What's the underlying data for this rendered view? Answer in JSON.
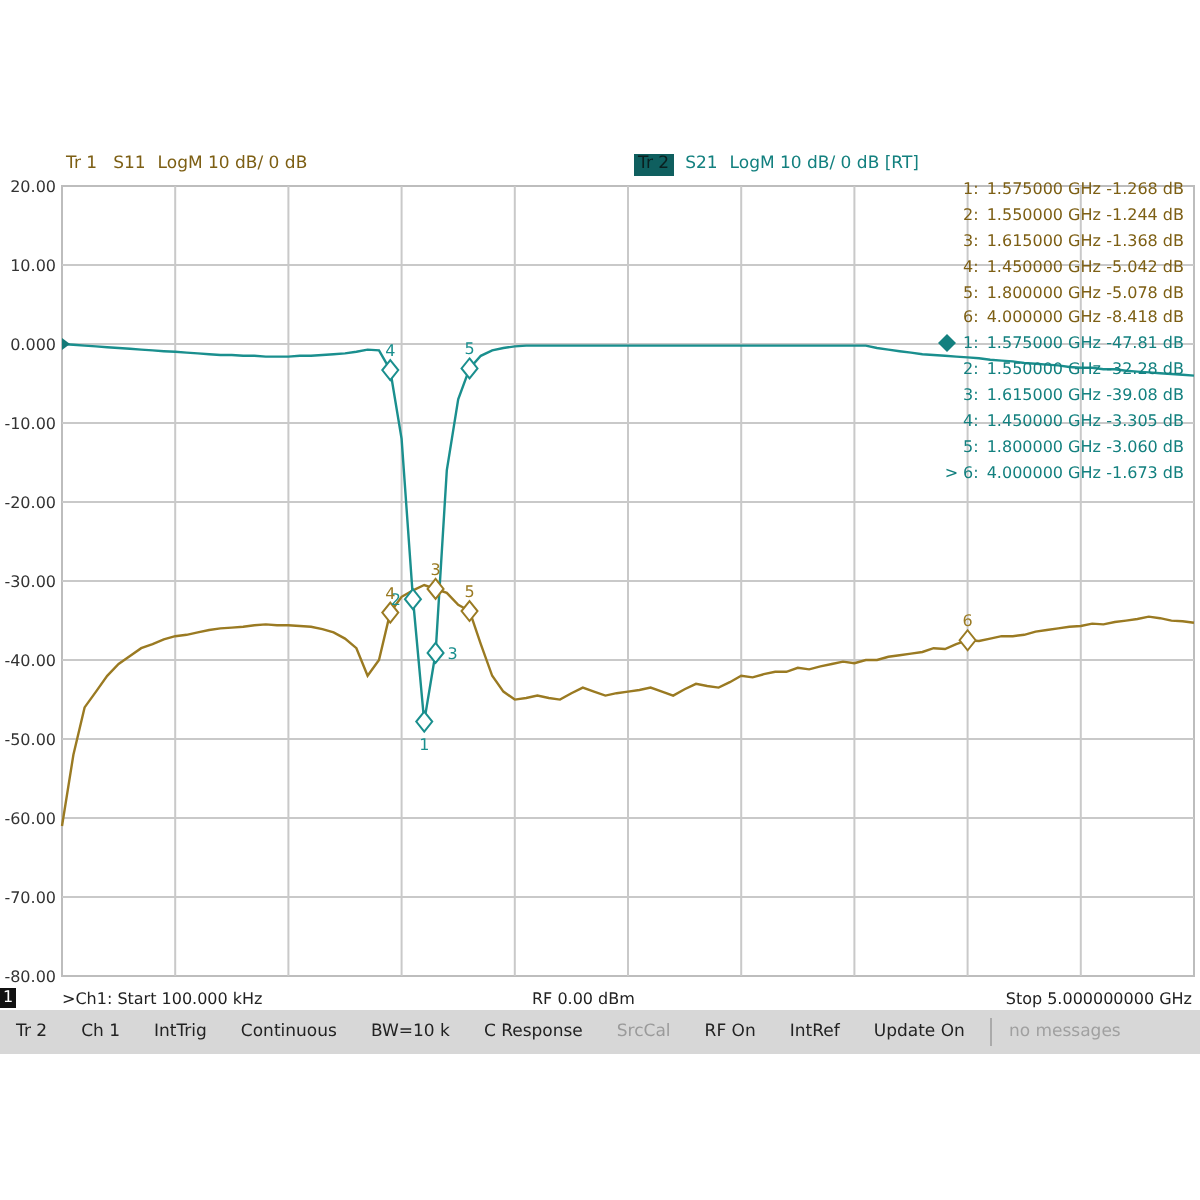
{
  "trace_header": [
    {
      "badge": "Tr 1",
      "format": "LogM 10 dB/ 0 dB",
      "selected": false,
      "color": "#7d5f14"
    },
    {
      "badge": "Tr 2",
      "format": "LogM 10 dB/ 0 dB [RT]",
      "selected": true,
      "color": "#13807f"
    }
  ],
  "chart": {
    "chart_data": {
      "type": "line",
      "grid": true,
      "ylim": [
        -80,
        20
      ],
      "yticks": [
        {
          "value": 20,
          "label": "20.00"
        },
        {
          "value": 10,
          "label": "10.00"
        },
        {
          "value": 0,
          "label": "0.000"
        },
        {
          "value": -10,
          "label": "-10.00"
        },
        {
          "value": -20,
          "label": "-20.00"
        },
        {
          "value": -30,
          "label": "-30.00"
        },
        {
          "value": -40,
          "label": "-40.00"
        },
        {
          "value": -50,
          "label": "-50.00"
        },
        {
          "value": -60,
          "label": "-60.00"
        },
        {
          "value": -70,
          "label": "-70.00"
        },
        {
          "value": -80,
          "label": "-80.00"
        }
      ],
      "categories": [
        null,
        null,
        null,
        null,
        null,
        null,
        null,
        null,
        null,
        null,
        null,
        null,
        null,
        null,
        null,
        null,
        null,
        null,
        null,
        null,
        null,
        null,
        null,
        null,
        null,
        null,
        null,
        null,
        null,
        null,
        null,
        null,
        null,
        null,
        null,
        null,
        null,
        null,
        null,
        null,
        null,
        null,
        null,
        null,
        null,
        null,
        null,
        null,
        null,
        null,
        null,
        null,
        null,
        null,
        null,
        null,
        null,
        null,
        null,
        null,
        null,
        null,
        null,
        null,
        null,
        null,
        null,
        null,
        null,
        null,
        null,
        null,
        null,
        null,
        null,
        null,
        null,
        null,
        null,
        null,
        null,
        null,
        null,
        null,
        null,
        null,
        null,
        null,
        null,
        null,
        null,
        null,
        null,
        null,
        null,
        null,
        null,
        null,
        null,
        null,
        null
      ],
      "series": [
        {
          "name": "S11",
          "color": "#9a7a22",
          "values": [
            -61,
            -52,
            -46,
            -44,
            -42,
            -40.5,
            -39.5,
            -38.5,
            -38,
            -37.4,
            -37,
            -36.8,
            -36.5,
            -36.2,
            -36,
            -35.9,
            -35.8,
            -35.6,
            -35.5,
            -35.6,
            -35.6,
            -35.7,
            -35.8,
            -36.1,
            -36.5,
            -37.3,
            -38.5,
            -42,
            -40,
            -34,
            -32,
            -31.2,
            -30.5,
            -31,
            -31.5,
            -33,
            -33.8,
            -38,
            -42,
            -44,
            -45,
            -44.8,
            -44.5,
            -44.8,
            -45,
            -44.2,
            -43.5,
            -44,
            -44.5,
            -44.2,
            -44,
            -43.8,
            -43.5,
            -44,
            -44.5,
            -43.7,
            -43,
            -43.3,
            -43.5,
            -42.8,
            -42,
            -42.2,
            -41.8,
            -41.5,
            -41.5,
            -41,
            -41.2,
            -40.8,
            -40.5,
            -40.2,
            -40.4,
            -40,
            -40,
            -39.6,
            -39.4,
            -39.2,
            -39,
            -38.5,
            -38.6,
            -38,
            -37.5,
            -37.6,
            -37.3,
            -37,
            -37,
            -36.8,
            -36.4,
            -36.2,
            -36,
            -35.8,
            -35.7,
            -35.4,
            -35.5,
            -35.2,
            -35,
            -34.8,
            -34.5,
            -34.7,
            -35,
            -35.1,
            -35.3
          ]
        },
        {
          "name": "S21",
          "color": "#1a8f8e",
          "values": [
            0,
            -0.1,
            -0.2,
            -0.3,
            -0.4,
            -0.5,
            -0.6,
            -0.7,
            -0.8,
            -0.9,
            -1.0,
            -1.1,
            -1.2,
            -1.3,
            -1.4,
            -1.4,
            -1.5,
            -1.5,
            -1.6,
            -1.6,
            -1.6,
            -1.5,
            -1.5,
            -1.4,
            -1.3,
            -1.2,
            -1.0,
            -0.7,
            -0.8,
            -3.3,
            -12,
            -32.3,
            -47.8,
            -39.1,
            -16,
            -7,
            -3.1,
            -1.5,
            -0.8,
            -0.5,
            -0.3,
            -0.2,
            -0.2,
            -0.2,
            -0.2,
            -0.2,
            -0.2,
            -0.2,
            -0.2,
            -0.2,
            -0.2,
            -0.2,
            -0.2,
            -0.2,
            -0.2,
            -0.2,
            -0.2,
            -0.2,
            -0.2,
            -0.2,
            -0.2,
            -0.2,
            -0.2,
            -0.2,
            -0.2,
            -0.2,
            -0.2,
            -0.2,
            -0.2,
            -0.2,
            -0.2,
            -0.2,
            -0.5,
            -0.7,
            -0.9,
            -1.1,
            -1.3,
            -1.4,
            -1.5,
            -1.6,
            -1.7,
            -1.8,
            -2.0,
            -2.1,
            -2.2,
            -2.4,
            -2.5,
            -2.6,
            -2.7,
            -2.9,
            -3.0,
            -3.0,
            -3.2,
            -3.2,
            -3.4,
            -3.5,
            -3.6,
            -3.7,
            -3.8,
            -3.9,
            -4.0
          ]
        }
      ],
      "annotations": [
        {
          "text": "4",
          "y": -3.3
        },
        {
          "text": "5",
          "y": -3.1
        },
        {
          "text": "2",
          "y": -32.3
        },
        {
          "text": "3",
          "y": -39.1
        },
        {
          "text": "1",
          "y": -47.8
        },
        {
          "text": "4",
          "y": -34
        },
        {
          "text": "3",
          "y": -31
        },
        {
          "text": "5",
          "y": -33.8
        },
        {
          "text": "6",
          "y": -37.5
        }
      ]
    }
  },
  "marker_table": [
    {
      "index": "1:",
      "frequency": "1.575000 GHz",
      "value": "-1.268 dB",
      "color": "#7d5f14",
      "active": false
    },
    {
      "index": "2:",
      "frequency": "1.550000 GHz",
      "value": "-1.244 dB",
      "color": "#7d5f14",
      "active": false
    },
    {
      "index": "3:",
      "frequency": "1.615000 GHz",
      "value": "-1.368 dB",
      "color": "#7d5f14",
      "active": false
    },
    {
      "index": "4:",
      "frequency": "1.450000 GHz",
      "value": "-5.042 dB",
      "color": "#7d5f14",
      "active": false
    },
    {
      "index": "5:",
      "frequency": "1.800000 GHz",
      "value": "-5.078 dB",
      "color": "#7d5f14",
      "active": false
    },
    {
      "index": "6:",
      "frequency": "4.000000 GHz",
      "value": "-8.418 dB",
      "color": "#7d5f14",
      "active": false
    },
    {
      "index": "1:",
      "frequency": "1.575000 GHz",
      "value": "-47.81 dB",
      "color": "#13807f",
      "active": true
    },
    {
      "index": "2:",
      "frequency": "1.550000 GHz",
      "value": "-32.28 dB",
      "color": "#13807f",
      "active": false
    },
    {
      "index": "3:",
      "frequency": "1.615000 GHz",
      "value": "-39.08 dB",
      "color": "#13807f",
      "active": false
    },
    {
      "index": "4:",
      "frequency": "1.450000 GHz",
      "value": "-3.305 dB",
      "color": "#13807f",
      "active": false
    },
    {
      "index": "5:",
      "frequency": "1.800000 GHz",
      "value": "-3.060 dB",
      "color": "#13807f",
      "active": false
    },
    {
      "index": "> 6:",
      "frequency": "4.000000 GHz",
      "value": "-1.673 dB",
      "color": "#13807f",
      "active": false
    }
  ],
  "axis_footer": {
    "channel": "1",
    "start": ">Ch1: Start 100.000 kHz",
    "power": "RF 0.00 dBm",
    "stop": "Stop 5.000000000 GHz"
  },
  "status_bar": {
    "items": [
      {
        "label": "Tr 2",
        "disabled": false
      },
      {
        "label": "Ch 1",
        "disabled": false
      },
      {
        "label": "IntTrig",
        "disabled": false
      },
      {
        "label": "Continuous",
        "disabled": false
      },
      {
        "label": "BW=10 k",
        "disabled": false
      },
      {
        "label": "C Response",
        "disabled": false
      },
      {
        "label": "SrcCal",
        "disabled": true
      },
      {
        "label": "RF On",
        "disabled": false
      },
      {
        "label": "IntRef",
        "disabled": false
      },
      {
        "label": "Update On",
        "disabled": false
      }
    ],
    "message": "no messages"
  }
}
